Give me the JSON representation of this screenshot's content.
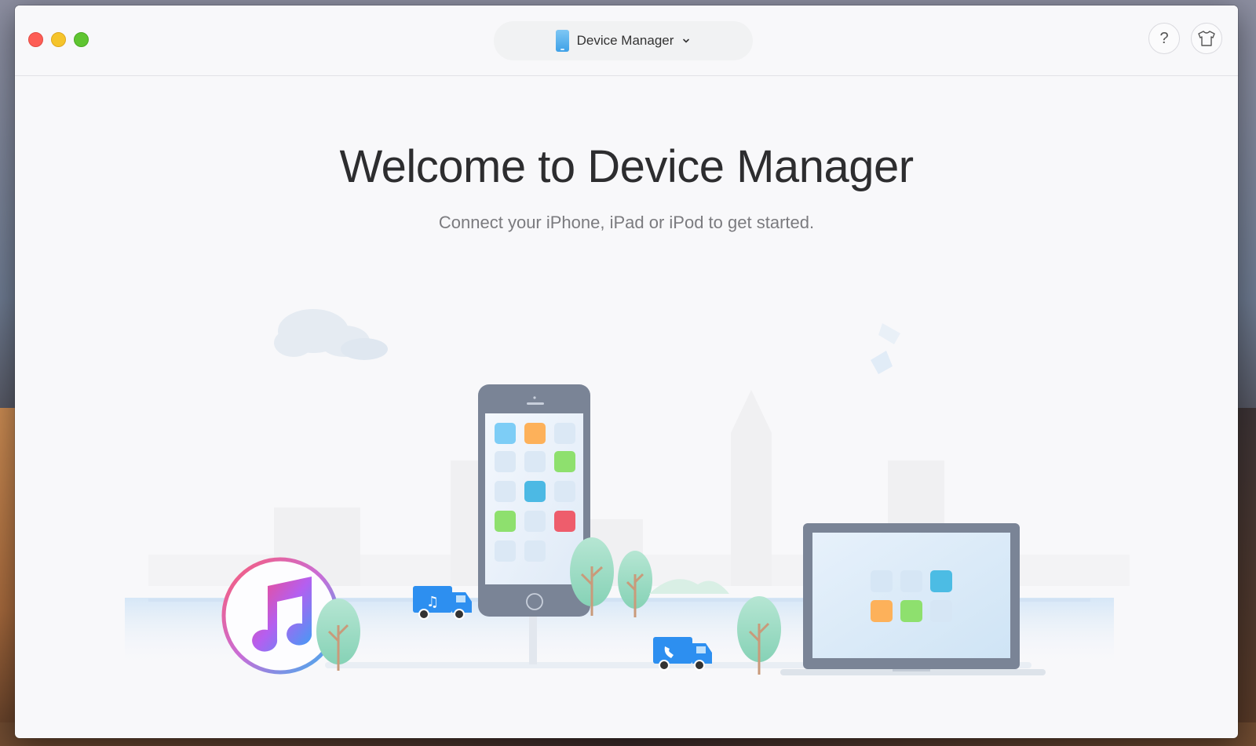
{
  "window": {
    "device_selector_label": "Device Manager",
    "help_label": "?"
  },
  "welcome": {
    "title": "Welcome to Device Manager",
    "subtitle": "Connect your iPhone, iPad or iPod to get started."
  },
  "icons": {
    "close": "close-button",
    "minimize": "minimize-button",
    "zoom": "zoom-button",
    "device": "iphone-icon",
    "dropdown": "chevron-down-icon",
    "help": "question-icon",
    "skin": "tshirt-icon"
  },
  "colors": {
    "accent_blue": "#3ea1e7",
    "close": "#fd5d55",
    "minimize": "#f5c42b",
    "zoom": "#5fc531"
  }
}
